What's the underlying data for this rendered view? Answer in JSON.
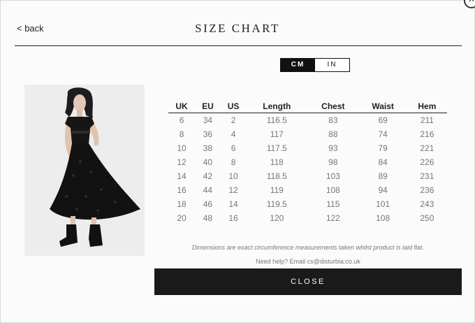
{
  "header": {
    "back_label": "< back",
    "title": "SIZE CHART",
    "close_icon_glyph": "×"
  },
  "unit_toggle": {
    "options": [
      "CM",
      "IN"
    ],
    "selected": "CM"
  },
  "product_image": {
    "alt": "Model wearing black lace midi dress with chunky black boots"
  },
  "size_table": {
    "columns": [
      "UK",
      "EU",
      "US",
      "Length",
      "Chest",
      "Waist",
      "Hem"
    ],
    "rows": [
      [
        "6",
        "34",
        "2",
        "116.5",
        "83",
        "69",
        "211"
      ],
      [
        "8",
        "36",
        "4",
        "117",
        "88",
        "74",
        "216"
      ],
      [
        "10",
        "38",
        "6",
        "117.5",
        "93",
        "79",
        "221"
      ],
      [
        "12",
        "40",
        "8",
        "118",
        "98",
        "84",
        "226"
      ],
      [
        "14",
        "42",
        "10",
        "118.5",
        "103",
        "89",
        "231"
      ],
      [
        "16",
        "44",
        "12",
        "119",
        "108",
        "94",
        "236"
      ],
      [
        "18",
        "46",
        "14",
        "119.5",
        "115",
        "101",
        "243"
      ],
      [
        "20",
        "48",
        "16",
        "120",
        "122",
        "108",
        "250"
      ]
    ]
  },
  "footer": {
    "disclaimer": "Dimensions are exact circumference measurements taken whilst product is laid flat.",
    "help": "Need help? Email cs@disturbia.co.uk",
    "close_label": "CLOSE"
  },
  "colors": {
    "accent": "#1a1a1a",
    "background": "#fbfbfb",
    "muted_text": "#777777"
  }
}
